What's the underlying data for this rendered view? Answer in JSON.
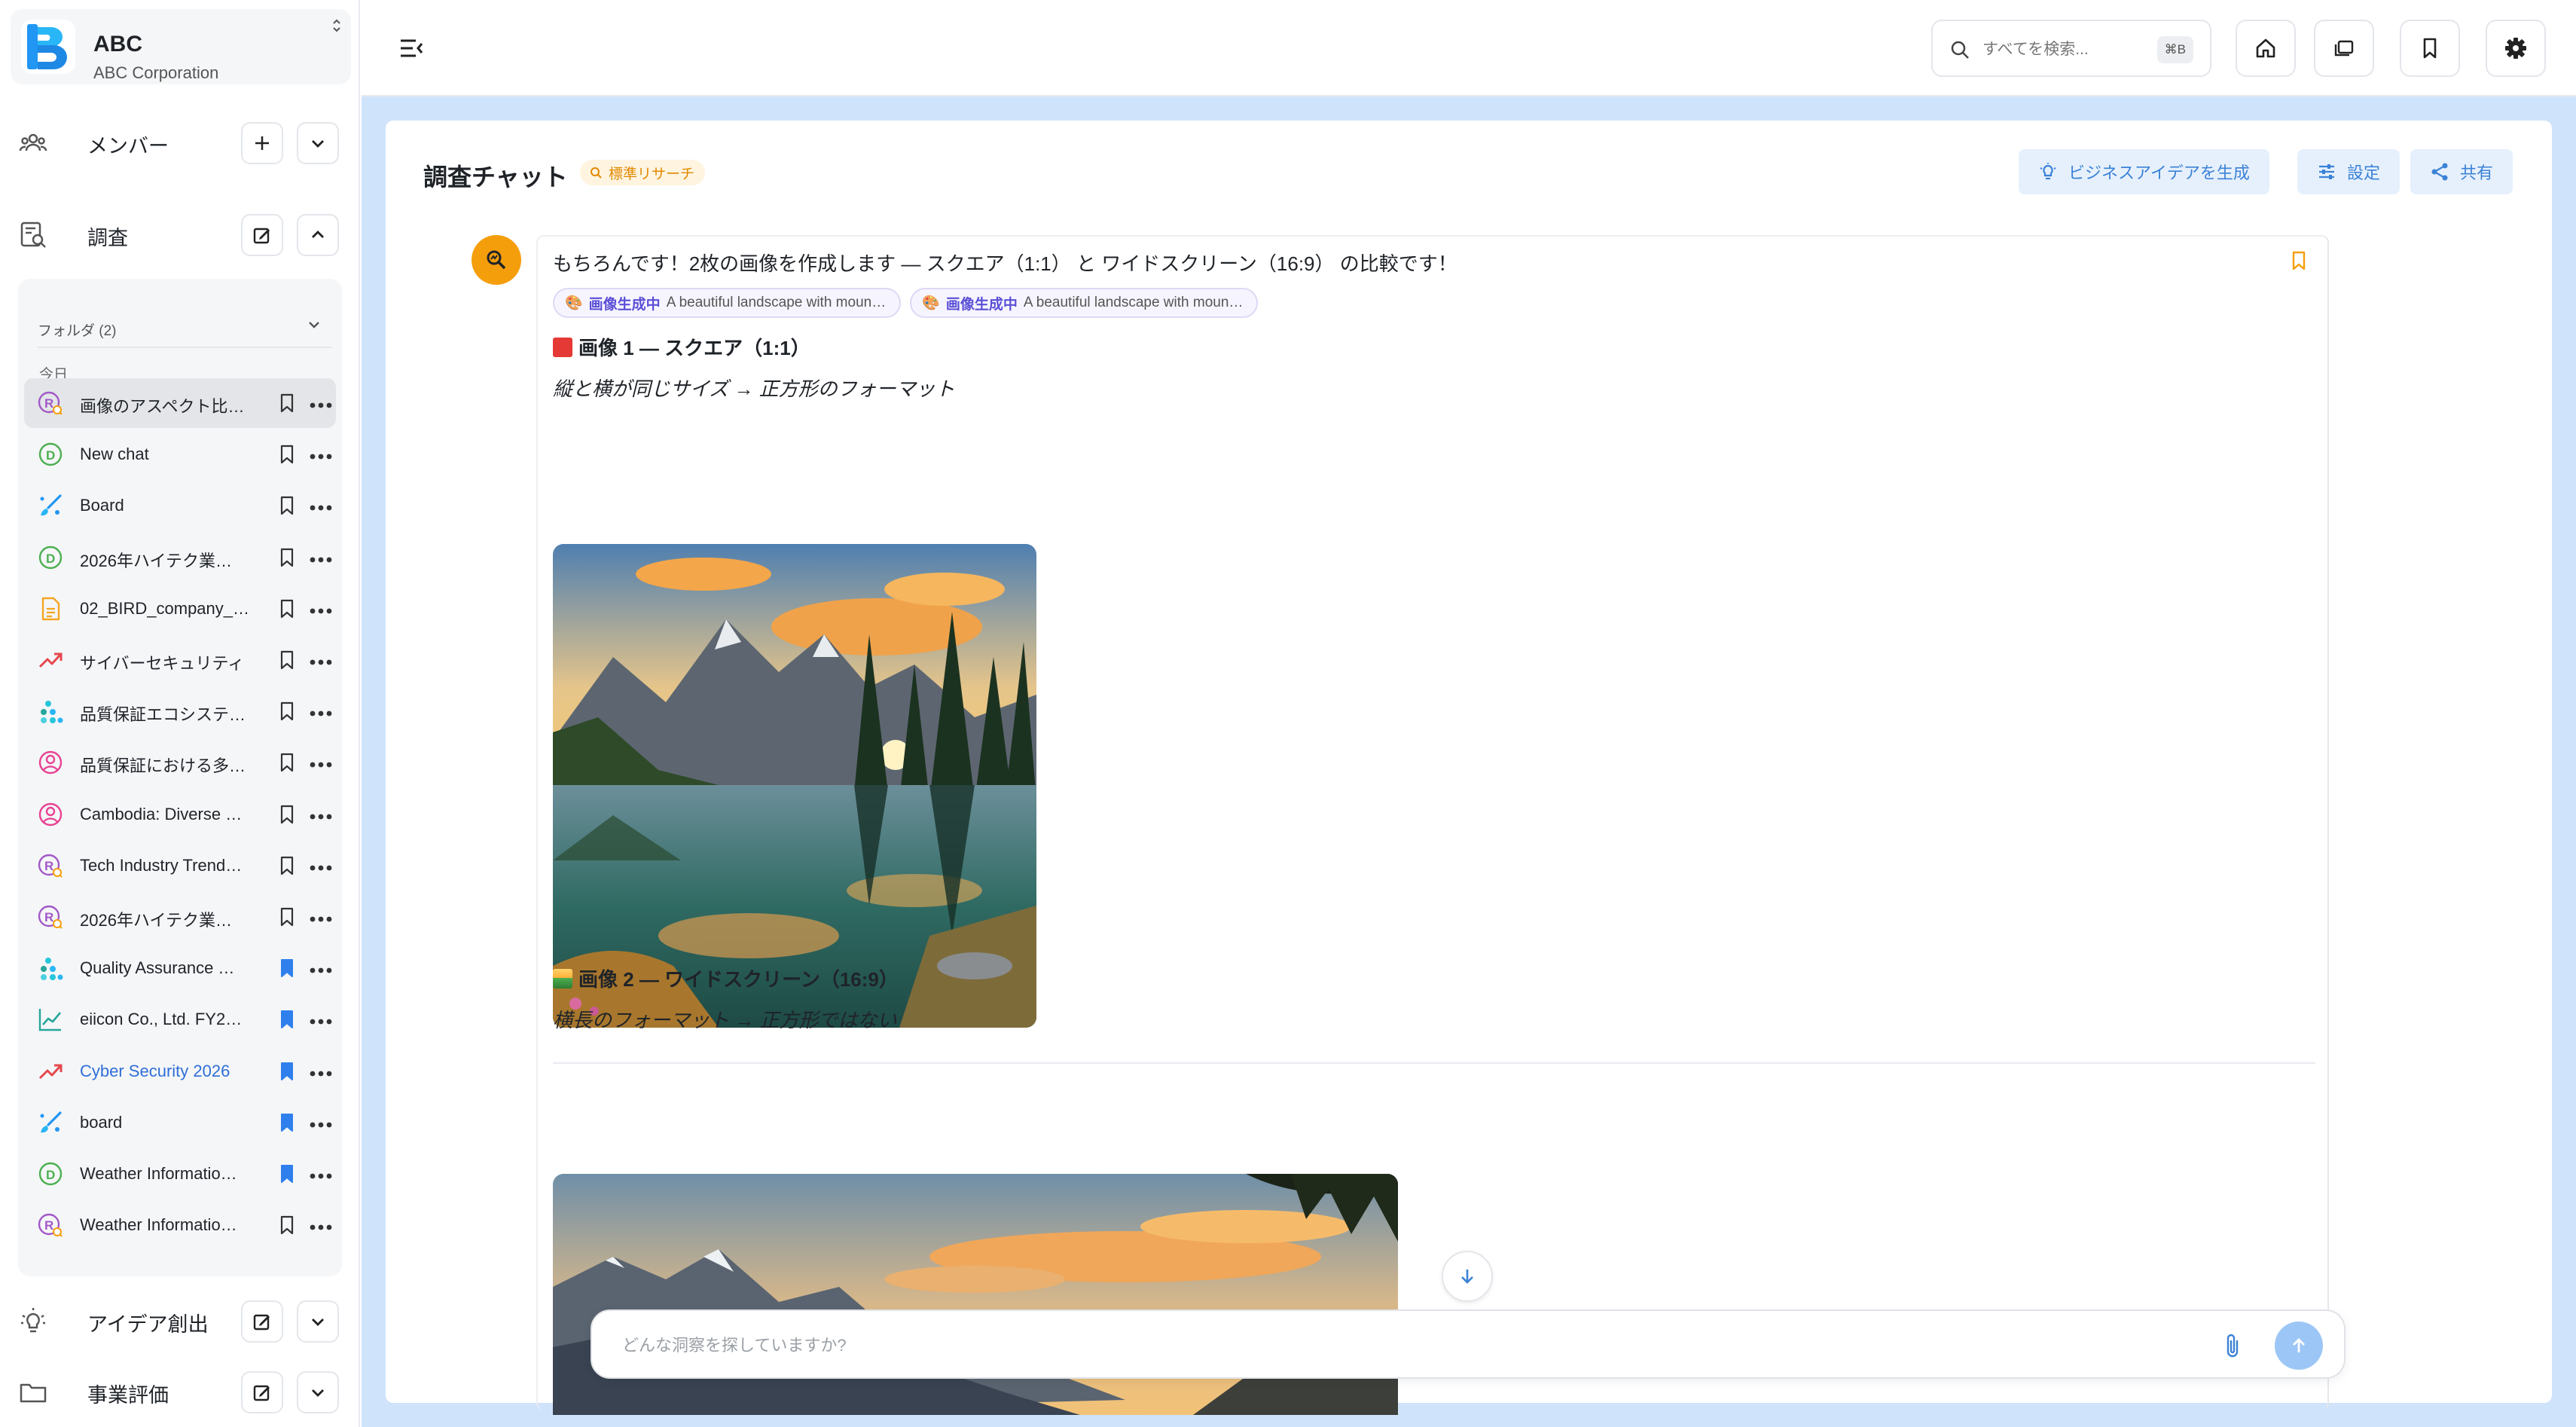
{
  "org": {
    "name": "ABC",
    "subtitle": "ABC Corporation"
  },
  "sidebar": {
    "members_label": "メンバー",
    "research_label": "調査",
    "folder_label": "フォルダ (2)",
    "today_label": "今日",
    "ideas_label": "アイデア創出",
    "evaluation_label": "事業評価",
    "items": [
      {
        "label": "画像のアスペクト比…",
        "icon": "research-r-icon",
        "bookmarked": false,
        "active": true
      },
      {
        "label": "New chat",
        "icon": "data-d-icon",
        "bookmarked": false
      },
      {
        "label": "Board",
        "icon": "brush-icon",
        "bookmarked": false
      },
      {
        "label": "2026年ハイテク業…",
        "icon": "data-d-icon",
        "bookmarked": false
      },
      {
        "label": "02_BIRD_company_…",
        "icon": "document-icon",
        "bookmarked": false
      },
      {
        "label": "サイバーセキュリティ",
        "icon": "trend-up-icon",
        "bookmarked": false
      },
      {
        "label": "品質保証エコシステ…",
        "icon": "scatter-icon",
        "bookmarked": false
      },
      {
        "label": "品質保証における多…",
        "icon": "persona-icon",
        "bookmarked": false
      },
      {
        "label": "Cambodia: Diverse …",
        "icon": "persona-icon",
        "bookmarked": false
      },
      {
        "label": "Tech Industry Trend…",
        "icon": "research-r-icon",
        "bookmarked": false
      },
      {
        "label": "2026年ハイテク業…",
        "icon": "research-r-icon",
        "bookmarked": false
      },
      {
        "label": "Quality Assurance …",
        "icon": "scatter-icon",
        "bookmarked": true
      },
      {
        "label": "eiicon Co., Ltd. FY2…",
        "icon": "line-chart-icon",
        "bookmarked": true
      },
      {
        "label": "Cyber Security 2026",
        "icon": "trend-up-icon",
        "bookmarked": true,
        "link": true
      },
      {
        "label": "board",
        "icon": "brush-icon",
        "bookmarked": true
      },
      {
        "label": "Weather Informatio…",
        "icon": "data-d-icon",
        "bookmarked": true
      },
      {
        "label": "Weather Informatio…",
        "icon": "research-r-icon",
        "bookmarked": false
      }
    ]
  },
  "topbar": {
    "search_placeholder": "すべてを検索...",
    "search_shortcut": "⌘B"
  },
  "chat": {
    "title": "調査チャット",
    "mode_tag": "標準リサーチ",
    "actions": {
      "idea": "ビジネスアイデアを生成",
      "settings": "設定",
      "share": "共有"
    },
    "message": {
      "intro": "もちろんです！2枚の画像を作成します — スクエア（1:1） と ワイドスクリーン（16:9） の比較です！",
      "chips": [
        {
          "status": "画像生成中",
          "desc": "A beautiful landscape with moun…"
        },
        {
          "status": "画像生成中",
          "desc": "A beautiful landscape with moun…"
        }
      ],
      "image1_heading": "画像 1 — スクエア（1:1）",
      "image1_caption": "縦と横が同じサイズ → 正方形のフォーマット",
      "image2_heading": "画像 2 — ワイドスクリーン（16:9）",
      "image2_caption": "横長のフォーマット → 正方形ではない"
    },
    "composer_placeholder": "どんな洞察を探していますか?"
  },
  "colors": {
    "accent": "#3b82d6",
    "content_bg": "#cfe3fb",
    "avatar": "#f59e0b",
    "tag_text": "#e08a00",
    "send": "#9cc6f5"
  }
}
